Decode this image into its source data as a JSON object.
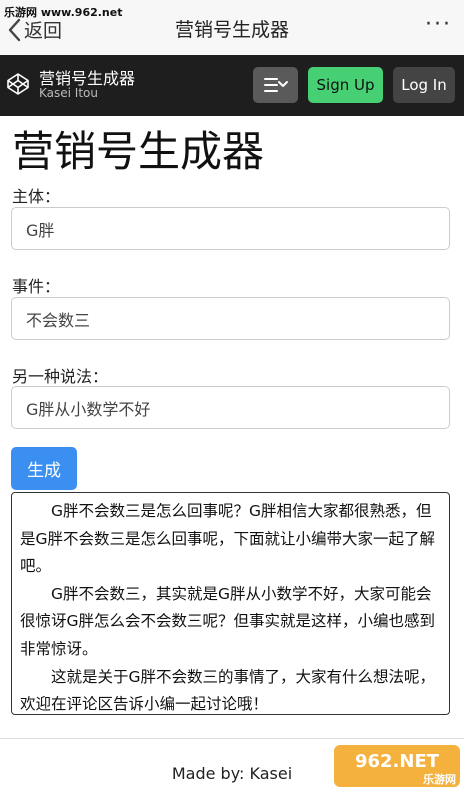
{
  "watermark": {
    "top_text": "乐游网 www.962.net",
    "logo_text": "962.NET",
    "logo_sub": "乐游网"
  },
  "nav": {
    "back_label": "返回",
    "title": "营销号生成器",
    "more": "···"
  },
  "header": {
    "app_name": "营销号生成器",
    "author": "Kasei Itou",
    "signup_label": "Sign Up",
    "login_label": "Log In"
  },
  "page": {
    "heading": "营销号生成器"
  },
  "form": {
    "subject_label": "主体：",
    "subject_value": "G胖",
    "event_label": "事件：",
    "event_value": "不会数三",
    "alt_label": "另一种说法：",
    "alt_value": "G胖从小数学不好",
    "generate_label": "生成"
  },
  "output": {
    "p1": "G胖不会数三是怎么回事呢？G胖相信大家都很熟悉，但是G胖不会数三是怎么回事呢，下面就让小编带大家一起了解吧。",
    "p2": "G胖不会数三，其实就是G胖从小数学不好，大家可能会很惊讶G胖怎么会不会数三呢？但事实就是这样，小编也感到非常惊讶。",
    "p3": "这就是关于G胖不会数三的事情了，大家有什么想法呢，欢迎在评论区告诉小编一起讨论哦！"
  },
  "footer": {
    "text": "Made by: Kasei"
  },
  "colors": {
    "header_bg": "#1e1e1e",
    "signup": "#47cf73",
    "generate": "#3b8ff0"
  }
}
